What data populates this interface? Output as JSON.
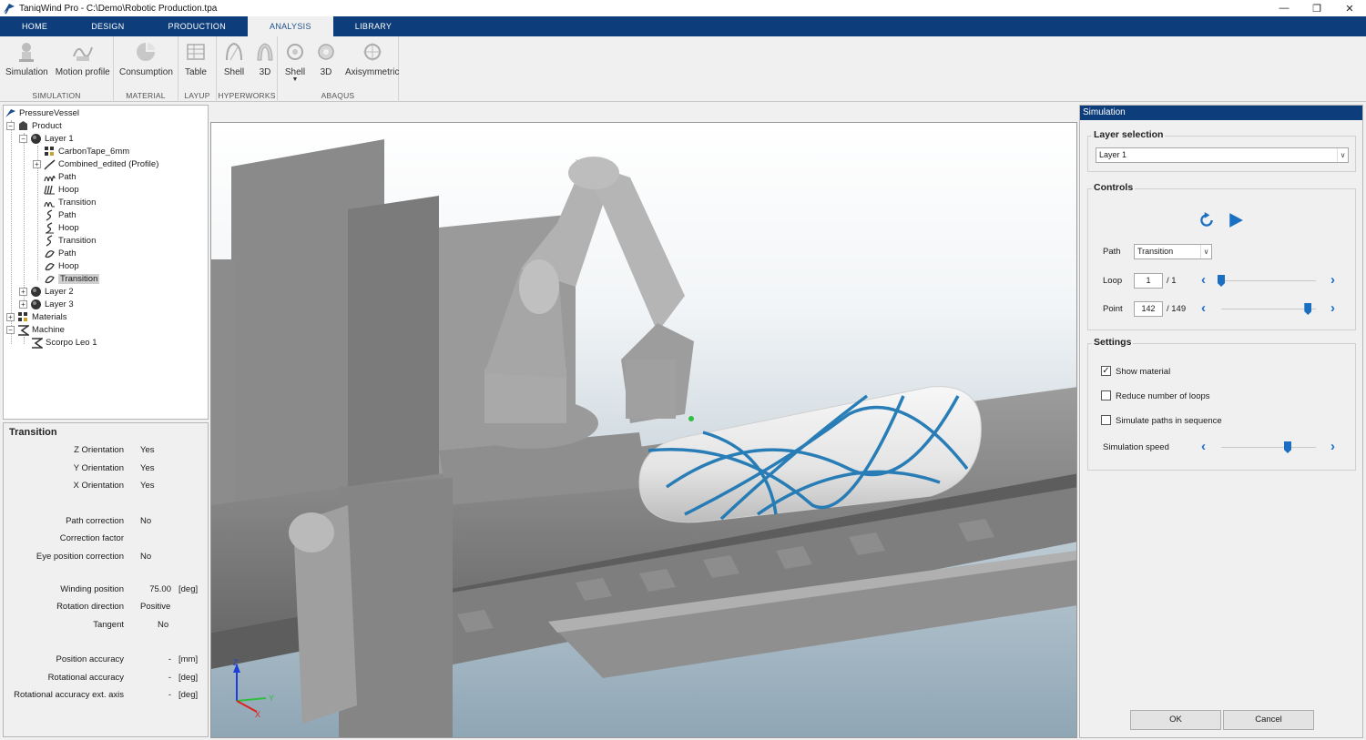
{
  "window": {
    "title": "TaniqWind Pro - C:\\Demo\\Robotic Production.tpa"
  },
  "tabs": [
    "HOME",
    "DESIGN",
    "PRODUCTION",
    "ANALYSIS",
    "LIBRARY"
  ],
  "ribbon": {
    "groups": [
      {
        "name": "SIMULATION",
        "buttons": [
          {
            "label": "Simulation",
            "icon": "robot-icon"
          },
          {
            "label": "Motion profile",
            "icon": "motion-profile-icon"
          }
        ]
      },
      {
        "name": "MATERIAL",
        "buttons": [
          {
            "label": "Consumption",
            "icon": "consumption-icon"
          }
        ]
      },
      {
        "name": "LAYUP",
        "buttons": [
          {
            "label": "Table",
            "icon": "table-icon"
          }
        ]
      },
      {
        "name": "HYPERWORKS",
        "buttons": [
          {
            "label": "Shell",
            "icon": "shell-icon"
          },
          {
            "label": "3D",
            "icon": "solid-3d-icon"
          }
        ]
      },
      {
        "name": "ABAQUS",
        "buttons": [
          {
            "label": "Shell",
            "icon": "abaqus-shell-icon"
          },
          {
            "label": "3D",
            "icon": "abaqus-3d-icon"
          },
          {
            "label": "Axisymmetric",
            "icon": "axisymmetric-icon"
          }
        ]
      }
    ]
  },
  "tree": {
    "items": [
      "PressureVessel",
      "Product",
      "Layer 1",
      "CarbonTape_6mm",
      "Combined_edited (Profile)",
      "Path",
      "Hoop",
      "Transition",
      "Path",
      "Hoop",
      "Transition",
      "Path",
      "Hoop",
      "Transition",
      "Layer 2",
      "Layer 3",
      "Materials",
      "Machine",
      "Scorpo Leo 1"
    ]
  },
  "properties": {
    "title": "Transition",
    "rows": [
      {
        "key": "Z Orientation",
        "value": "Yes",
        "unit": ""
      },
      {
        "key": "Y Orientation",
        "value": "Yes",
        "unit": ""
      },
      {
        "key": "X Orientation",
        "value": "Yes",
        "unit": ""
      },
      {
        "key": "Path correction",
        "value": "No",
        "unit": ""
      },
      {
        "key": "Correction factor",
        "value": "",
        "unit": ""
      },
      {
        "key": "Eye position correction",
        "value": "No",
        "unit": ""
      },
      {
        "key": "Winding position",
        "value": "75.00",
        "unit": "[deg]"
      },
      {
        "key": "Rotation direction",
        "value": "Positive",
        "unit": ""
      },
      {
        "key": "Tangent",
        "value": "No",
        "unit": ""
      },
      {
        "key": "Position accuracy",
        "value": "-",
        "unit": "[mm]"
      },
      {
        "key": "Rotational accuracy",
        "value": "-",
        "unit": "[deg]"
      },
      {
        "key": "Rotational accuracy ext. axis",
        "value": "-",
        "unit": "[deg]"
      }
    ]
  },
  "axes": {
    "z": "Z",
    "y": "Y",
    "x": "X"
  },
  "simulation": {
    "title": "Simulation",
    "layer_selection": {
      "legend": "Layer selection",
      "value": "Layer 1"
    },
    "controls": {
      "legend": "Controls",
      "path_label": "Path",
      "path_value": "Transition",
      "loop_label": "Loop",
      "loop_value": "1",
      "loop_total": "/ 1",
      "loop_fraction": 0.0,
      "point_label": "Point",
      "point_value": "142",
      "point_total": "/ 149",
      "point_fraction": 0.953
    },
    "settings": {
      "legend": "Settings",
      "show_material": "Show material",
      "show_material_checked": true,
      "reduce_loops": "Reduce number of loops",
      "reduce_loops_checked": false,
      "simulate_sequence": "Simulate paths in sequence",
      "simulate_sequence_checked": false,
      "speed_label": "Simulation speed",
      "speed_fraction": 0.73
    },
    "ok": "OK",
    "cancel": "Cancel"
  },
  "colors": {
    "accent": "#0d3d7a",
    "control_blue": "#1b6fc2",
    "fiber": "#1f78b4",
    "selection": "#cfcfcf"
  }
}
